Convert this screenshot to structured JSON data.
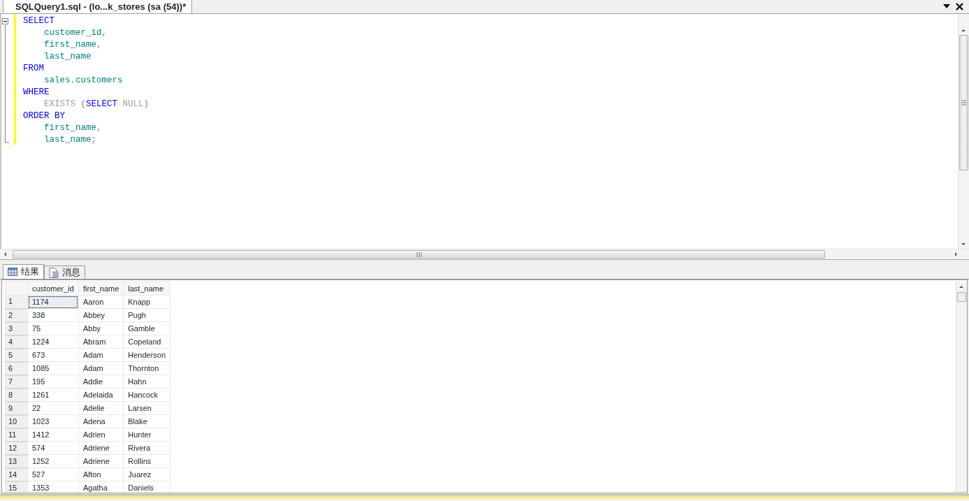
{
  "document_tab": {
    "title": "SQLQuery1.sql - (lo...k_stores (sa (54))*",
    "selected": true
  },
  "editor": {
    "lines": [
      {
        "indent": false,
        "tokens": [
          {
            "kind": "keyword",
            "text": "SELECT"
          }
        ]
      },
      {
        "indent": true,
        "tokens": [
          {
            "kind": "identifier",
            "text": "customer_id"
          },
          {
            "kind": "punct",
            "text": ","
          }
        ]
      },
      {
        "indent": true,
        "tokens": [
          {
            "kind": "identifier",
            "text": "first_name"
          },
          {
            "kind": "punct",
            "text": ","
          }
        ]
      },
      {
        "indent": true,
        "tokens": [
          {
            "kind": "identifier",
            "text": "last_name"
          }
        ]
      },
      {
        "indent": false,
        "tokens": [
          {
            "kind": "keyword",
            "text": "FROM"
          }
        ]
      },
      {
        "indent": true,
        "tokens": [
          {
            "kind": "identifier",
            "text": "sales"
          },
          {
            "kind": "punct",
            "text": "."
          },
          {
            "kind": "identifier",
            "text": "customers"
          }
        ]
      },
      {
        "indent": false,
        "tokens": [
          {
            "kind": "keyword",
            "text": "WHERE"
          }
        ]
      },
      {
        "indent": true,
        "tokens": [
          {
            "kind": "function",
            "text": "EXISTS "
          },
          {
            "kind": "punct",
            "text": "("
          },
          {
            "kind": "keyword",
            "text": "SELECT "
          },
          {
            "kind": "function",
            "text": "NULL"
          },
          {
            "kind": "punct",
            "text": ")"
          }
        ]
      },
      {
        "indent": false,
        "tokens": [
          {
            "kind": "keyword",
            "text": "ORDER BY"
          }
        ]
      },
      {
        "indent": true,
        "tokens": [
          {
            "kind": "identifier",
            "text": "first_name"
          },
          {
            "kind": "punct",
            "text": ","
          }
        ]
      },
      {
        "indent": true,
        "tokens": [
          {
            "kind": "identifier",
            "text": "last_name"
          },
          {
            "kind": "punct",
            "text": ";"
          }
        ]
      }
    ]
  },
  "result_tabs": [
    {
      "label": "结果",
      "kind": "grid",
      "selected": true
    },
    {
      "label": "消息",
      "kind": "messages",
      "selected": false
    }
  ],
  "table": {
    "columns": [
      "customer_id",
      "first_name",
      "last_name"
    ],
    "rows": [
      {
        "num": "1",
        "cells": [
          "1174",
          "Aaron",
          "Knapp"
        ],
        "focused": true
      },
      {
        "num": "2",
        "cells": [
          "338",
          "Abbey",
          "Pugh"
        ],
        "focused": false
      },
      {
        "num": "3",
        "cells": [
          "75",
          "Abby",
          "Gamble"
        ],
        "focused": false
      },
      {
        "num": "4",
        "cells": [
          "1224",
          "Abram",
          "Copeland"
        ],
        "focused": false
      },
      {
        "num": "5",
        "cells": [
          "673",
          "Adam",
          "Henderson"
        ],
        "focused": false
      },
      {
        "num": "6",
        "cells": [
          "1085",
          "Adam",
          "Thornton"
        ],
        "focused": false
      },
      {
        "num": "7",
        "cells": [
          "195",
          "Addie",
          "Hahn"
        ],
        "focused": false
      },
      {
        "num": "8",
        "cells": [
          "1261",
          "Adelaida",
          "Hancock"
        ],
        "focused": false
      },
      {
        "num": "9",
        "cells": [
          "22",
          "Adelle",
          "Larsen"
        ],
        "focused": false
      },
      {
        "num": "10",
        "cells": [
          "1023",
          "Adena",
          "Blake"
        ],
        "focused": false
      },
      {
        "num": "11",
        "cells": [
          "1412",
          "Adrien",
          "Hunter"
        ],
        "focused": false
      },
      {
        "num": "12",
        "cells": [
          "574",
          "Adriene",
          "Rivera"
        ],
        "focused": false
      },
      {
        "num": "13",
        "cells": [
          "1252",
          "Adriene",
          "Rollins"
        ],
        "focused": false
      },
      {
        "num": "14",
        "cells": [
          "527",
          "Afton",
          "Juarez"
        ],
        "focused": false
      },
      {
        "num": "15",
        "cells": [
          "1353",
          "Agatha",
          "Daniels"
        ],
        "focused": false
      }
    ]
  }
}
